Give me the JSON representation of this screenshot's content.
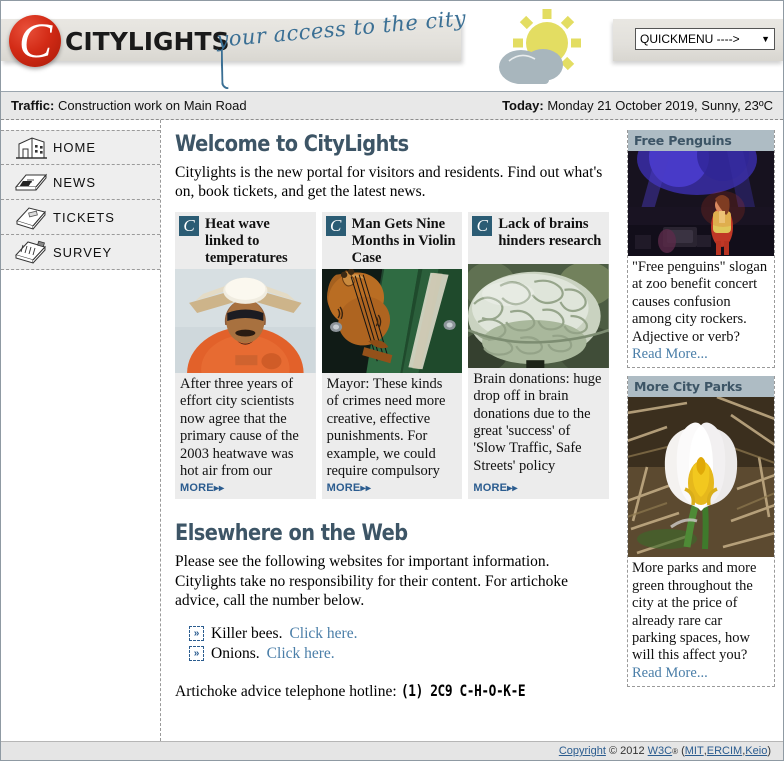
{
  "header": {
    "logo_word": "CITYLIGHTS",
    "logo_letter": "C",
    "tagline": "your access to the city",
    "weather_icon": "sun-behind-cloud-icon",
    "quickmenu_label": "QUICKMENU ---->",
    "quickmenu_arrow": "▼"
  },
  "traffic": {
    "traffic_label": "Traffic:",
    "traffic_value": "Construction work on Main Road",
    "today_label": "Today:",
    "today_value": "Monday 21 October 2019, Sunny, 23ºC"
  },
  "sidebar": {
    "items": [
      {
        "label": "HOME",
        "icon": "building-icon"
      },
      {
        "label": "NEWS",
        "icon": "newspaper-icon"
      },
      {
        "label": "TICKETS",
        "icon": "ticket-icon"
      },
      {
        "label": "SURVEY",
        "icon": "clipboard-icon"
      }
    ]
  },
  "main": {
    "welcome_title": "Welcome to CityLights",
    "welcome_text": "Citylights is the new portal for visitors and residents. Find out what's on, book tickets, and get the latest news.",
    "cards": [
      {
        "badge": "C",
        "title": "Heat wave linked to temperatures",
        "image": "man-with-cardboard-sun-hat-photo",
        "text": "After three years of effort city scientists now agree that the primary cause of the 2003 heatwave was hot air from our",
        "more_label": "MORE",
        "more_chevron": "▸▸"
      },
      {
        "badge": "C",
        "title": "Man Gets Nine Months in Violin Case",
        "image": "violin-in-green-case-photo",
        "text": "Mayor: These kinds of crimes need more creative, effective punishments. For example, we could require compulsory",
        "more_label": "MORE",
        "more_chevron": "▸▸"
      },
      {
        "badge": "C",
        "title": "Lack of brains hinders research",
        "image": "anatomical-brain-model-photo",
        "text": "Brain donations: huge drop off in brain donations due to the great 'success' of 'Slow Traffic, Safe Streets' policy",
        "more_label": "MORE",
        "more_chevron": "▸▸"
      }
    ],
    "elsewhere": {
      "title": "Elsewhere on the Web",
      "text": "Please see the following websites for important information. Citylights take no responsibility for their content. For artichoke advice, call the number below.",
      "links": [
        {
          "bullet": "»",
          "text": "Killer bees.",
          "link_label": "Click here."
        },
        {
          "bullet": "»",
          "text": "Onions.",
          "link_label": "Click here."
        }
      ],
      "hotline_label": "Artichoke advice telephone hotline:",
      "hotline_number": "(1) 2C9 C-H-O-K-E"
    }
  },
  "aside": {
    "panels": [
      {
        "title": "Free Penguins",
        "image": "concert-stage-photo",
        "text": "\"Free penguins\" slogan at zoo benefit concert causes confusion among city rockers. Adjective or verb?",
        "read_more": "Read More..."
      },
      {
        "title": "More City Parks",
        "image": "white-crocus-flower-photo",
        "text": "More parks and more green throughout the city at the price of already rare car parking spaces, how will this affect you?",
        "read_more": "Read More..."
      }
    ]
  },
  "footer": {
    "copyright_link": "Copyright",
    "copyright_symbol": "©",
    "year": "2012",
    "w3c": "W3C",
    "registered": "®",
    "open_paren": "(",
    "mit": "MIT",
    "sep1": ", ",
    "ercim": "ERCIM",
    "sep2": ", ",
    "keio": "Keio",
    "close_paren": ")"
  },
  "colors": {
    "logo_red": "#d32b16",
    "tagline_blue": "#3a6f94",
    "heading_slate": "#3d5566",
    "badge_teal": "#2b5c74",
    "link_blue": "#4a7ea8",
    "panel_head": "#aebcc4",
    "card_bg": "#ececec",
    "sun_yellow": "#e3dd62",
    "cloud_gray": "#a8b6bd"
  }
}
